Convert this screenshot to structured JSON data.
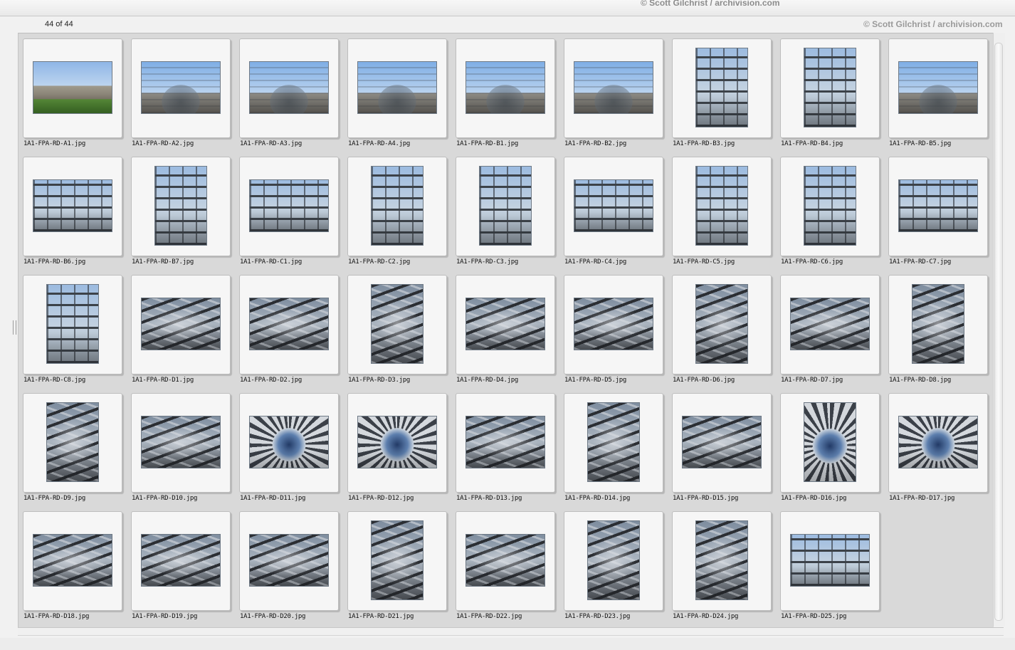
{
  "watermarks": {
    "top": "© Scott Gilchrist / archivision.com",
    "corner": "© Scott Gilchrist / archivision.com"
  },
  "status": {
    "count_label": "44 of 44"
  },
  "thumbnails": [
    {
      "filename": "1A1-FPA-RD-A1.jpg",
      "orientation": "landscape",
      "scene": "ext"
    },
    {
      "filename": "1A1-FPA-RD-A2.jpg",
      "orientation": "landscape",
      "scene": "dome"
    },
    {
      "filename": "1A1-FPA-RD-A3.jpg",
      "orientation": "landscape",
      "scene": "dome"
    },
    {
      "filename": "1A1-FPA-RD-A4.jpg",
      "orientation": "landscape",
      "scene": "dome"
    },
    {
      "filename": "1A1-FPA-RD-B1.jpg",
      "orientation": "landscape",
      "scene": "dome"
    },
    {
      "filename": "1A1-FPA-RD-B2.jpg",
      "orientation": "landscape",
      "scene": "dome"
    },
    {
      "filename": "1A1-FPA-RD-B3.jpg",
      "orientation": "portrait",
      "scene": "facade"
    },
    {
      "filename": "1A1-FPA-RD-B4.jpg",
      "orientation": "portrait",
      "scene": "facade"
    },
    {
      "filename": "1A1-FPA-RD-B5.jpg",
      "orientation": "landscape",
      "scene": "dome"
    },
    {
      "filename": "1A1-FPA-RD-B6.jpg",
      "orientation": "landscape",
      "scene": "facade"
    },
    {
      "filename": "1A1-FPA-RD-B7.jpg",
      "orientation": "portrait",
      "scene": "facade"
    },
    {
      "filename": "1A1-FPA-RD-C1.jpg",
      "orientation": "landscape",
      "scene": "facade"
    },
    {
      "filename": "1A1-FPA-RD-C2.jpg",
      "orientation": "portrait",
      "scene": "facade"
    },
    {
      "filename": "1A1-FPA-RD-C3.jpg",
      "orientation": "portrait",
      "scene": "facade"
    },
    {
      "filename": "1A1-FPA-RD-C4.jpg",
      "orientation": "landscape",
      "scene": "facade"
    },
    {
      "filename": "1A1-FPA-RD-C5.jpg",
      "orientation": "portrait",
      "scene": "facade"
    },
    {
      "filename": "1A1-FPA-RD-C6.jpg",
      "orientation": "portrait",
      "scene": "facade"
    },
    {
      "filename": "1A1-FPA-RD-C7.jpg",
      "orientation": "landscape",
      "scene": "facade"
    },
    {
      "filename": "1A1-FPA-RD-C8.jpg",
      "orientation": "portrait",
      "scene": "facade"
    },
    {
      "filename": "1A1-FPA-RD-D1.jpg",
      "orientation": "landscape",
      "scene": "interior"
    },
    {
      "filename": "1A1-FPA-RD-D2.jpg",
      "orientation": "landscape",
      "scene": "interior"
    },
    {
      "filename": "1A1-FPA-RD-D3.jpg",
      "orientation": "portrait",
      "scene": "interior"
    },
    {
      "filename": "1A1-FPA-RD-D4.jpg",
      "orientation": "landscape",
      "scene": "interior"
    },
    {
      "filename": "1A1-FPA-RD-D5.jpg",
      "orientation": "landscape",
      "scene": "interior"
    },
    {
      "filename": "1A1-FPA-RD-D6.jpg",
      "orientation": "portrait",
      "scene": "interior"
    },
    {
      "filename": "1A1-FPA-RD-D7.jpg",
      "orientation": "landscape",
      "scene": "interior"
    },
    {
      "filename": "1A1-FPA-RD-D8.jpg",
      "orientation": "portrait",
      "scene": "interior"
    },
    {
      "filename": "1A1-FPA-RD-D9.jpg",
      "orientation": "portrait",
      "scene": "interior"
    },
    {
      "filename": "1A1-FPA-RD-D10.jpg",
      "orientation": "landscape",
      "scene": "interior"
    },
    {
      "filename": "1A1-FPA-RD-D11.jpg",
      "orientation": "landscape",
      "scene": "cone"
    },
    {
      "filename": "1A1-FPA-RD-D12.jpg",
      "orientation": "landscape",
      "scene": "cone"
    },
    {
      "filename": "1A1-FPA-RD-D13.jpg",
      "orientation": "landscape",
      "scene": "interior"
    },
    {
      "filename": "1A1-FPA-RD-D14.jpg",
      "orientation": "portrait",
      "scene": "interior"
    },
    {
      "filename": "1A1-FPA-RD-D15.jpg",
      "orientation": "landscape",
      "scene": "interior"
    },
    {
      "filename": "1A1-FPA-RD-D16.jpg",
      "orientation": "portrait",
      "scene": "cone"
    },
    {
      "filename": "1A1-FPA-RD-D17.jpg",
      "orientation": "landscape",
      "scene": "cone"
    },
    {
      "filename": "1A1-FPA-RD-D18.jpg",
      "orientation": "landscape",
      "scene": "interior"
    },
    {
      "filename": "1A1-FPA-RD-D19.jpg",
      "orientation": "landscape",
      "scene": "interior"
    },
    {
      "filename": "1A1-FPA-RD-D20.jpg",
      "orientation": "landscape",
      "scene": "interior"
    },
    {
      "filename": "1A1-FPA-RD-D21.jpg",
      "orientation": "portrait",
      "scene": "interior"
    },
    {
      "filename": "1A1-FPA-RD-D22.jpg",
      "orientation": "landscape",
      "scene": "interior"
    },
    {
      "filename": "1A1-FPA-RD-D23.jpg",
      "orientation": "portrait",
      "scene": "interior"
    },
    {
      "filename": "1A1-FPA-RD-D24.jpg",
      "orientation": "portrait",
      "scene": "interior"
    },
    {
      "filename": "1A1-FPA-RD-D25.jpg",
      "orientation": "landscape",
      "scene": "facade"
    }
  ]
}
